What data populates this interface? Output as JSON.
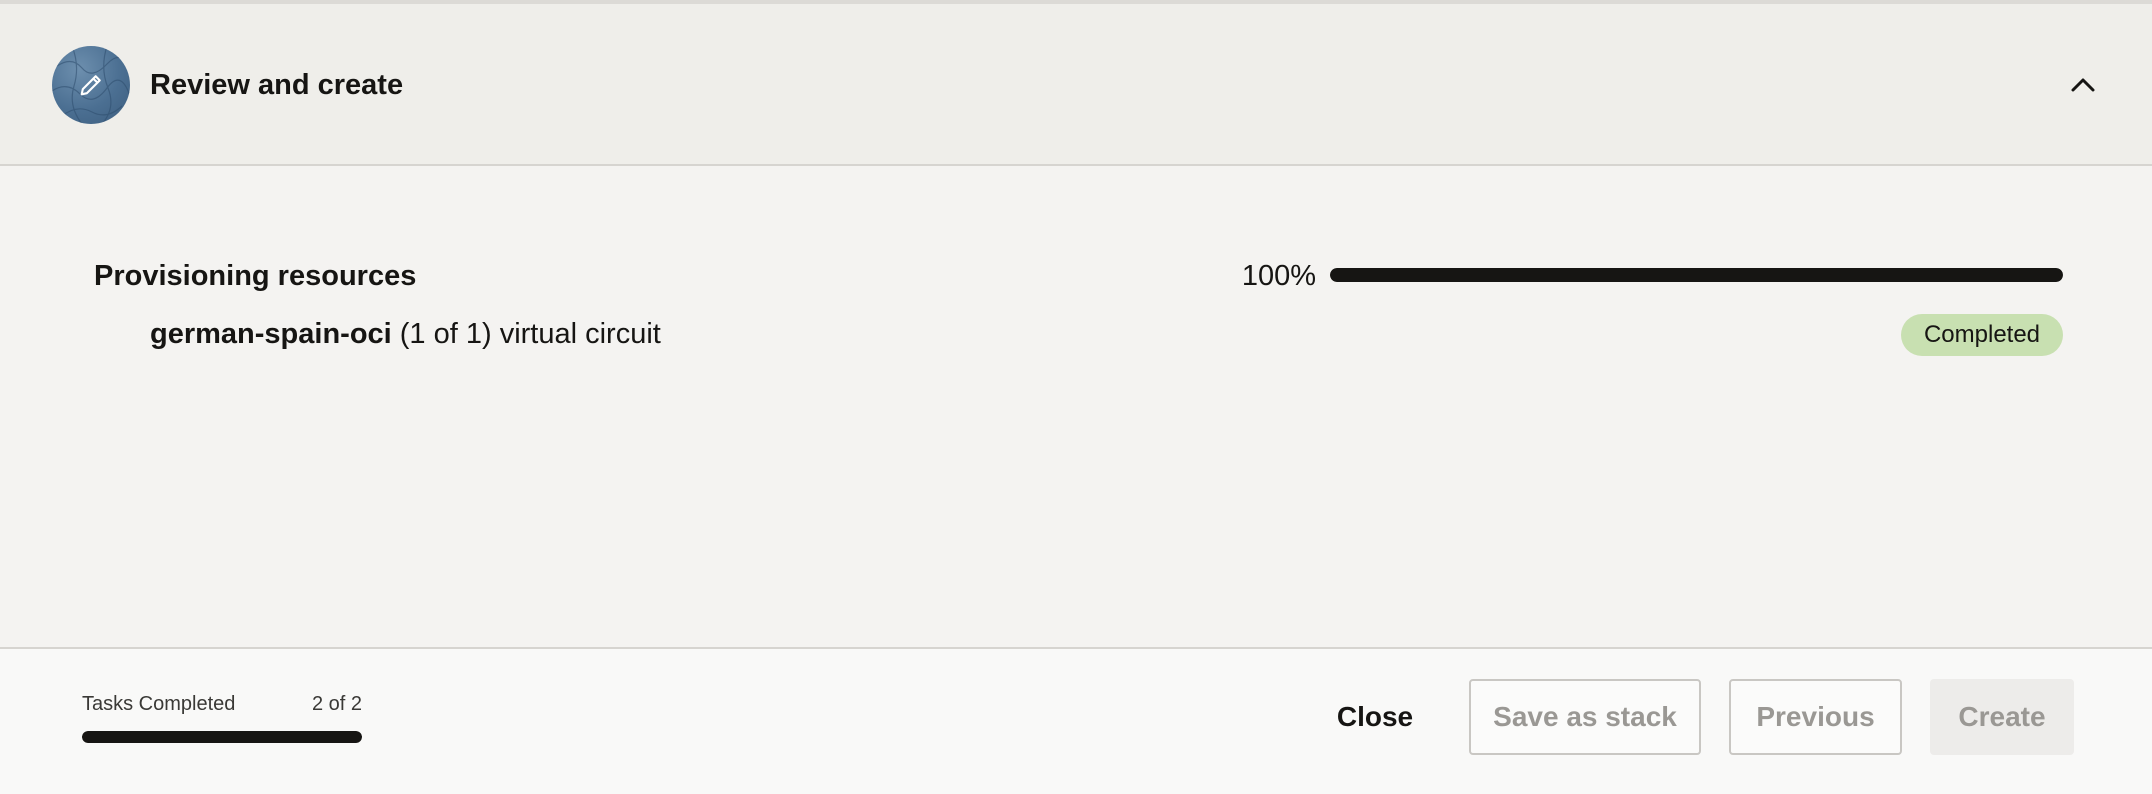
{
  "step": {
    "title": "Review and create",
    "icon": "pencil-icon",
    "collapse_icon": "chevron-up-icon"
  },
  "provisioning": {
    "title": "Provisioning resources",
    "percent_label": "100%",
    "progress": 1.0,
    "resource": {
      "name": "german-spain-oci",
      "detail": " (1 of 1) virtual circuit"
    },
    "status": "Completed",
    "status_color": "#c8e0b1"
  },
  "footer": {
    "tasks_label": "Tasks Completed",
    "tasks_count": "2 of 2",
    "tasks_progress": 1.0,
    "buttons": {
      "close": "Close",
      "save_stack": "Save as stack",
      "previous": "Previous",
      "create": "Create"
    }
  }
}
